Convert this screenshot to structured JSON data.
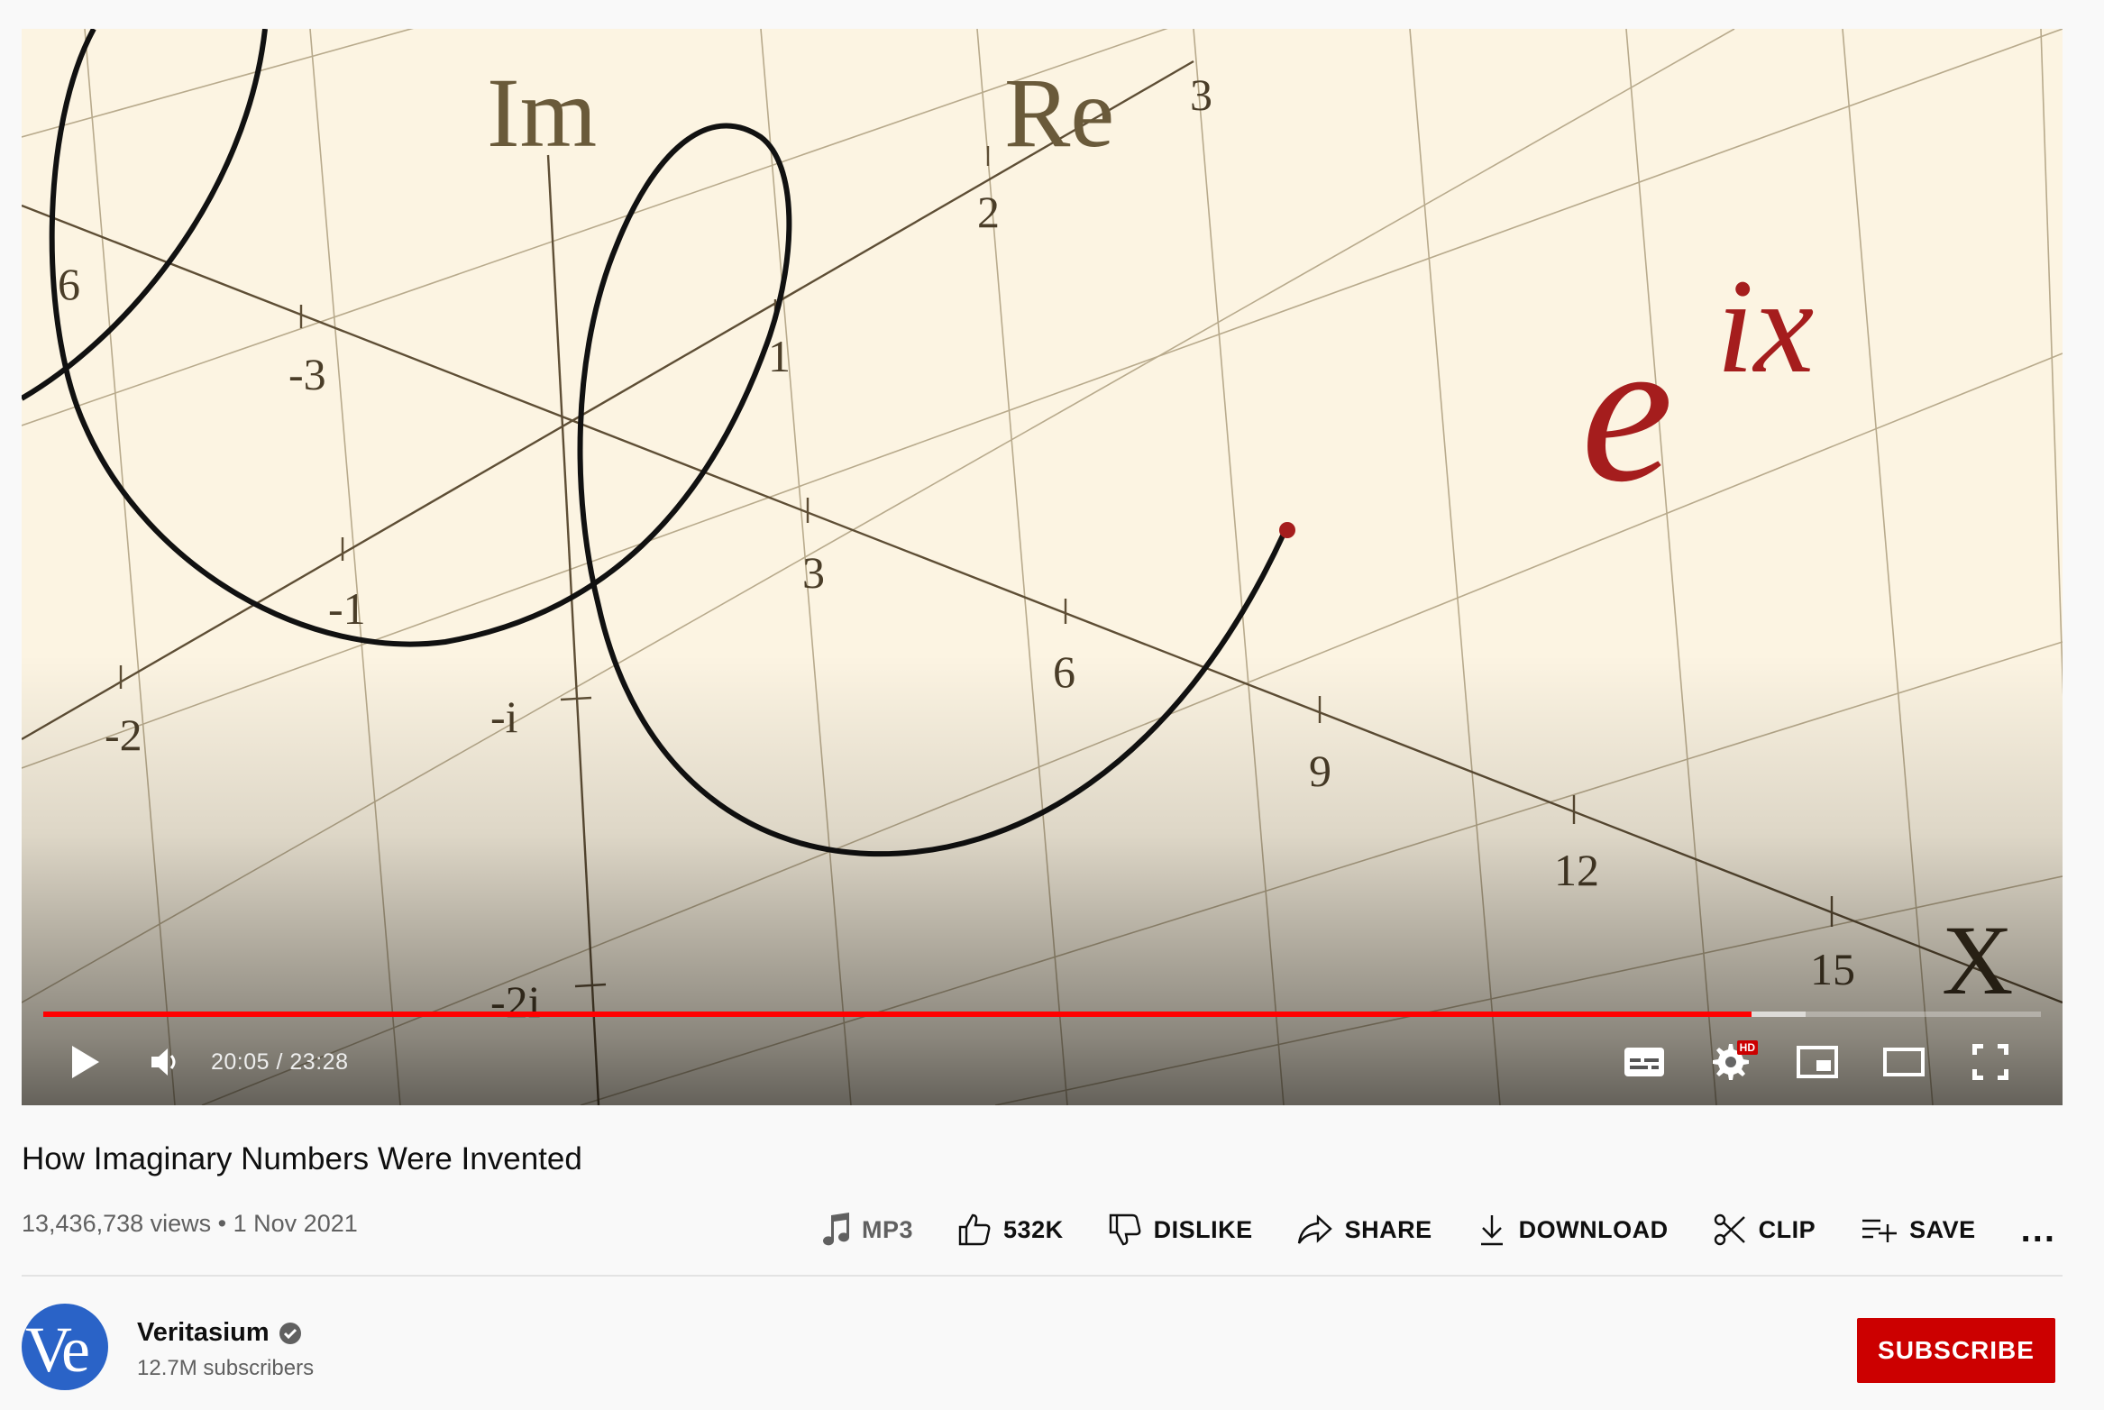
{
  "video": {
    "current_time": "20:05",
    "duration": "23:28",
    "time_separator": " / ",
    "progress_fraction": 0.855,
    "buffered_fraction": 0.882,
    "hd_badge": "HD",
    "frame_labels": {
      "im": "Im",
      "re": "Re",
      "x": "X",
      "formula_base": "e",
      "formula_exp": "ix",
      "re_ticks": [
        "2",
        "3",
        "1",
        "-1",
        "-2"
      ],
      "im_ticks": [
        "-i",
        "-2i"
      ],
      "x_ticks": [
        "6",
        "-3",
        "3",
        "6",
        "9",
        "12",
        "15"
      ]
    }
  },
  "title": "How Imaginary Numbers Were Invented",
  "meta": {
    "views": "13,436,738 views",
    "separator": "•",
    "date": "1 Nov 2021"
  },
  "actions": {
    "mp3": "MP3",
    "likes": "532K",
    "dislike": "DISLIKE",
    "share": "SHARE",
    "download": "DOWNLOAD",
    "clip": "CLIP",
    "save": "SAVE",
    "more": "..."
  },
  "channel": {
    "avatar_text": "Ve",
    "name": "Veritasium",
    "subscribers": "12.7M subscribers",
    "subscribe_label": "SUBSCRIBE",
    "brand_color": "#2a63c7"
  },
  "colors": {
    "accent": "#cc0000",
    "progress": "#ff0000",
    "frame_background": "#fcf4e2",
    "formula": "#a51d1d"
  }
}
